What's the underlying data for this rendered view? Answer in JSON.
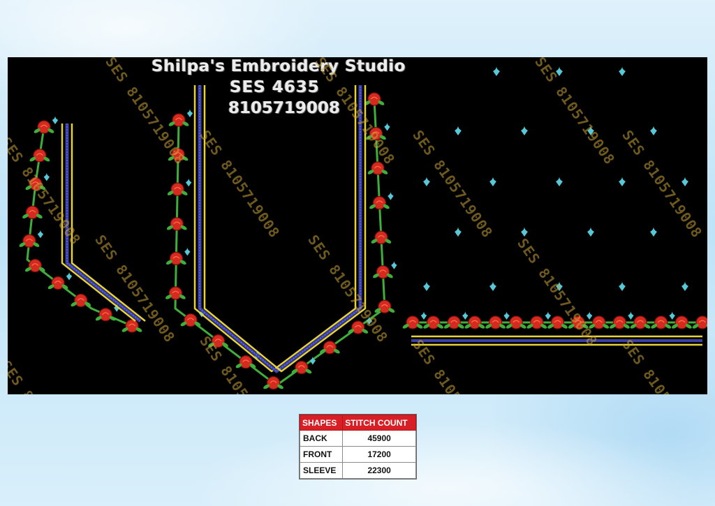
{
  "studio": {
    "name": "Shilpa's Embroidery Studio",
    "code": "SES  4635",
    "phone": "8105719008"
  },
  "watermark_text": "SES 8105719008",
  "colors": {
    "canvas": "#000000",
    "rose": "#d42a1f",
    "leaf": "#3fae3a",
    "bud": "#56c8d8",
    "gold_line": "#e6d23a",
    "blue_line": "#3a3ea8",
    "table_header": "#d81f26"
  },
  "stitch_table": {
    "headers": [
      "SHAPES",
      "STITCH COUNT"
    ],
    "rows": [
      {
        "shape": "BACK",
        "count": "45900"
      },
      {
        "shape": "FRONT",
        "count": "17200"
      },
      {
        "shape": "SLEEVE",
        "count": "22300"
      }
    ]
  }
}
